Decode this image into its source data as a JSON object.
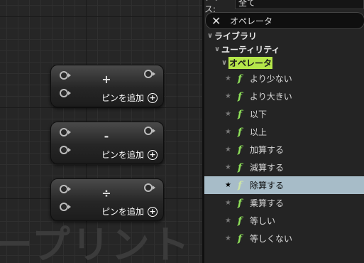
{
  "graph": {
    "watermark": "ープリント",
    "nodes": [
      {
        "operator": "+",
        "add_pin_label": "ピンを追加"
      },
      {
        "operator": "-",
        "add_pin_label": "ピンを追加"
      },
      {
        "operator": "÷",
        "add_pin_label": "ピンを追加"
      }
    ]
  },
  "panel": {
    "class_label": "クラス:",
    "class_value": "全て",
    "search": {
      "value": "オペレータ",
      "clear_icon": "close-icon"
    },
    "categories": [
      "ライブラリ",
      "ユーティリティ",
      "オペレータ"
    ],
    "items": [
      {
        "label": "より少ない",
        "favorite": false
      },
      {
        "label": "より大きい",
        "favorite": false
      },
      {
        "label": "以下",
        "favorite": false
      },
      {
        "label": "以上",
        "favorite": false
      },
      {
        "label": "加算する",
        "favorite": false
      },
      {
        "label": "減算する",
        "favorite": false
      },
      {
        "label": "除算する",
        "favorite": true,
        "selected": true
      },
      {
        "label": "乗算する",
        "favorite": false
      },
      {
        "label": "等しい",
        "favorite": false
      },
      {
        "label": "等しくない",
        "favorite": false
      }
    ],
    "function_glyph": "f",
    "selection_color": "#a7bcc8",
    "highlight_color": "#b5e64a"
  }
}
